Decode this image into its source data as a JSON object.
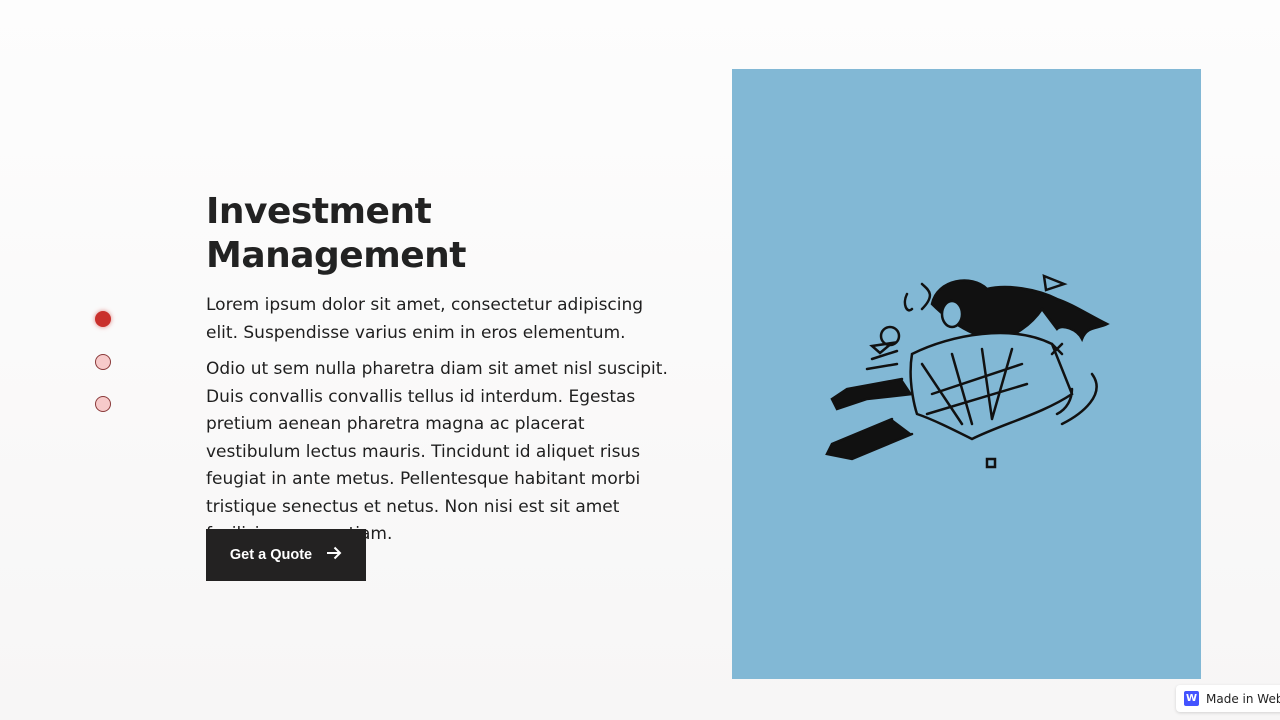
{
  "slider": {
    "dots": [
      {
        "active": true
      },
      {
        "active": false
      },
      {
        "active": false
      }
    ],
    "accent": "#c9302c"
  },
  "hero": {
    "title": "Investment Management",
    "paragraph1": "Lorem ipsum dolor sit amet, consectetur adipiscing elit. Suspendisse varius enim in eros elementum.",
    "paragraph2": "Odio ut sem nulla pharetra diam sit amet nisl suscipit. Duis convallis convallis tellus id interdum. Egestas pretium aenean pharetra magna ac placerat vestibulum lectus mauris. Tincidunt id aliquet risus feugiat in ante metus. Pellentesque habitant morbi tristique senectus et netus. Non nisi est sit amet facilisis magna etiam.",
    "cta_label": "Get a Quote",
    "cta_icon": "arrow-right-icon"
  },
  "image_panel": {
    "background": "#82b8d5",
    "illustration": "falling-person-illustration"
  },
  "badge": {
    "logo": "W",
    "label": "Made in Webf"
  }
}
